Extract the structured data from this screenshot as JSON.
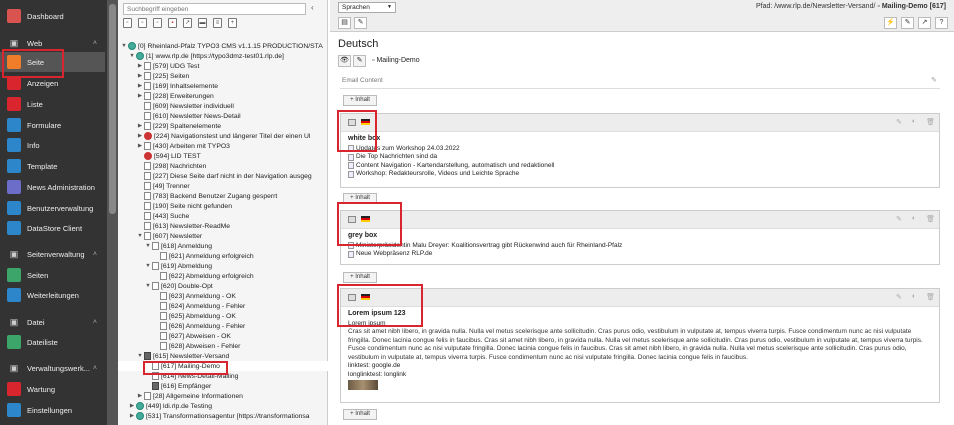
{
  "module_menu": {
    "items": [
      {
        "label": "Dashboard",
        "icon": "dashboard-icon",
        "color": "#d9534f"
      },
      {
        "label": "Web",
        "icon": "web-icon",
        "group": true
      },
      {
        "label": "Seite",
        "icon": "page-icon",
        "color": "#f07d29",
        "active": true
      },
      {
        "label": "Anzeigen",
        "icon": "eye-icon",
        "color": "#d9262e"
      },
      {
        "label": "Liste",
        "icon": "list-icon",
        "color": "#d9262e"
      },
      {
        "label": "Formulare",
        "icon": "form-icon",
        "color": "#2d86c9"
      },
      {
        "label": "Info",
        "icon": "info-icon",
        "color": "#2d86c9"
      },
      {
        "label": "Template",
        "icon": "template-icon",
        "color": "#2d86c9"
      },
      {
        "label": "News Administration",
        "icon": "news-icon",
        "color": "#6c6cc9"
      },
      {
        "label": "Benutzerverwaltung",
        "icon": "users-icon",
        "color": "#2d86c9"
      },
      {
        "label": "DataStore Client",
        "icon": "datastore-icon",
        "color": "#2d86c9"
      },
      {
        "label": "Seitenverwaltung",
        "icon": "site-management-icon",
        "group": true
      },
      {
        "label": "Seiten",
        "icon": "sites-icon",
        "color": "#3ca66a"
      },
      {
        "label": "Weiterleitungen",
        "icon": "redirect-icon",
        "color": "#2d86c9"
      },
      {
        "label": "Datei",
        "icon": "file-icon",
        "group": true
      },
      {
        "label": "Dateiliste",
        "icon": "filelist-icon",
        "color": "#3ca66a"
      },
      {
        "label": "Verwaltungswerk...",
        "icon": "admin-tools-icon",
        "group": true
      },
      {
        "label": "Wartung",
        "icon": "maintenance-icon",
        "color": "#d9262e"
      },
      {
        "label": "Einstellungen",
        "icon": "settings-icon",
        "color": "#2d86c9"
      }
    ]
  },
  "tree": {
    "search_placeholder": "Suchbegriff eingeben",
    "nodes": [
      {
        "label": "[0] Rheinland-Pfalz TYPO3 CMS v1.1.15 PRODUCTION/STA",
        "depth": 0,
        "toggle": "▼",
        "kind": "globe"
      },
      {
        "label": "[1] www.rlp.de [https://typo3dmz-test01.rlp.de]",
        "depth": 1,
        "toggle": "▼",
        "kind": "globe"
      },
      {
        "label": "[579] UDG Test",
        "depth": 2,
        "toggle": "▶",
        "kind": "page"
      },
      {
        "label": "[225] Seiten",
        "depth": 2,
        "toggle": "▶",
        "kind": "page"
      },
      {
        "label": "[169] Inhaltselemente",
        "depth": 2,
        "toggle": "▶",
        "kind": "page"
      },
      {
        "label": "[228] Erweiterungen",
        "depth": 2,
        "toggle": "▶",
        "kind": "page"
      },
      {
        "label": "[609] Newsletter individuell",
        "depth": 2,
        "toggle": "",
        "kind": "page"
      },
      {
        "label": "[610] Newsletter News-Detail",
        "depth": 2,
        "toggle": "",
        "kind": "page"
      },
      {
        "label": "[229] Spaltenelemente",
        "depth": 2,
        "toggle": "▶",
        "kind": "page"
      },
      {
        "label": "[224] Navigationstest und längerer Titel der einen Ul",
        "depth": 2,
        "toggle": "▶",
        "kind": "red"
      },
      {
        "label": "[430] Arbeiten mit TYPO3",
        "depth": 2,
        "toggle": "▶",
        "kind": "page"
      },
      {
        "label": "[594] LID TEST",
        "depth": 2,
        "toggle": "",
        "kind": "red"
      },
      {
        "label": "[298] Nachrichten",
        "depth": 2,
        "toggle": "",
        "kind": "page"
      },
      {
        "label": "[227] Diese Seite darf nicht in der Navigation ausgeg",
        "depth": 2,
        "toggle": "",
        "kind": "page"
      },
      {
        "label": "[49] Trenner",
        "depth": 2,
        "toggle": "",
        "kind": "page"
      },
      {
        "label": "[783] Backend Benutzer Zugang gesperrt",
        "depth": 2,
        "toggle": "",
        "kind": "page"
      },
      {
        "label": "[190] Seite nicht gefunden",
        "depth": 2,
        "toggle": "",
        "kind": "page"
      },
      {
        "label": "[443] Suche",
        "depth": 2,
        "toggle": "",
        "kind": "page"
      },
      {
        "label": "[613] Newsletter-ReadMe",
        "depth": 2,
        "toggle": "",
        "kind": "page"
      },
      {
        "label": "[607] Newsletter",
        "depth": 2,
        "toggle": "▼",
        "kind": "page"
      },
      {
        "label": "[618] Anmeldung",
        "depth": 3,
        "toggle": "▼",
        "kind": "page"
      },
      {
        "label": "[621] Anmeldung erfolgreich",
        "depth": 4,
        "toggle": "",
        "kind": "page"
      },
      {
        "label": "[619] Abmeldung",
        "depth": 3,
        "toggle": "▼",
        "kind": "page"
      },
      {
        "label": "[622] Abmeldung erfolgreich",
        "depth": 4,
        "toggle": "",
        "kind": "page"
      },
      {
        "label": "[620] Double-Opt",
        "depth": 3,
        "toggle": "▼",
        "kind": "page"
      },
      {
        "label": "[623] Anmeldung - OK",
        "depth": 4,
        "toggle": "",
        "kind": "page"
      },
      {
        "label": "[624] Anmeldung - Fehler",
        "depth": 4,
        "toggle": "",
        "kind": "page"
      },
      {
        "label": "[625] Abmeldung - OK",
        "depth": 4,
        "toggle": "",
        "kind": "page"
      },
      {
        "label": "[626] Anmeldung - Fehler",
        "depth": 4,
        "toggle": "",
        "kind": "page"
      },
      {
        "label": "[627] Abweisen - OK",
        "depth": 4,
        "toggle": "",
        "kind": "page"
      },
      {
        "label": "[628] Abweisen - Fehler",
        "depth": 4,
        "toggle": "",
        "kind": "page"
      },
      {
        "label": "[615] Newsletter-Versand",
        "depth": 2,
        "toggle": "▼",
        "kind": "dark"
      },
      {
        "label": "[617] Mailing-Demo",
        "depth": 3,
        "toggle": "",
        "kind": "page",
        "selected": true
      },
      {
        "label": "[614] News-Detail-Mailing",
        "depth": 3,
        "toggle": "",
        "kind": "page"
      },
      {
        "label": "[616] Empfänger",
        "depth": 3,
        "toggle": "",
        "kind": "dark"
      },
      {
        "label": "[28] Allgemeine Informationen",
        "depth": 2,
        "toggle": "▶",
        "kind": "page"
      },
      {
        "label": "[449] ldi.rlp.de Testing",
        "depth": 1,
        "toggle": "▶",
        "kind": "globe"
      },
      {
        "label": "[531] Transformationsagentur [https://transformationsa",
        "depth": 1,
        "toggle": "▶",
        "kind": "globe"
      }
    ]
  },
  "docheader": {
    "language": "Sprachen",
    "path_prefix": "Pfad: /www.rlp.de/Newsletter-Versand/",
    "path_current": "Mailing-Demo [617]"
  },
  "content": {
    "title": "Deutsch",
    "page_name": "Mailing-Demo",
    "colpos_label": "Email Content",
    "add_label": "Inhalt",
    "cards": [
      {
        "header": "white box",
        "items": [
          "Updates zum Workshop 24.03.2022",
          "Die Top Nachrichten sind da",
          "Content Navigation - Kartendarstellung, automatisch und redaktionell",
          "Workshop: Redakteursrolle, Videos und Leichte Sprache"
        ]
      },
      {
        "header": "grey box",
        "items": [
          "Ministerpräsidentin Malu Dreyer: Koalitionsvertrag gibt Rückenwind auch für Rheinland-Pfalz",
          "Neue Webpräsenz RLP.de"
        ]
      },
      {
        "header": "Lorem ipsum 123",
        "subheader": "Lorem ipsum",
        "paragraph": "Cras sit amet nibh libero, in gravida nulla. Nulla vel metus scelerisque ante sollicitudin. Cras purus odio, vestibulum in vulputate at, tempus viverra turpis. Fusce condimentum nunc ac nisi vulputate fringilla. Donec lacinia congue felis in faucibus. Cras sit amet nibh libero, in gravida nulla. Nulla vel metus scelerisque ante sollicitudin. Cras purus odio, vestibulum in vulputate at, tempus viverra turpis. Fusce condimentum nunc ac nisi vulputate fringilla. Donec lacinia congue felis in faucibus. Cras sit amet nibh libero, in gravida nulla. Nulla vel metus scelerisque ante sollicitudin. Cras purus odio, vestibulum in vulputate at, tempus viverra turpis. Fusce condimentum nunc ac nisi vulputate fringilla. Donec lacinia congue felis in faucibus.",
        "linktest": "linktest: google.de",
        "longlinktest": "longlinktest: longlink"
      }
    ]
  },
  "colors": {
    "highlight": "#d9262e",
    "module_bg": "#333333"
  }
}
